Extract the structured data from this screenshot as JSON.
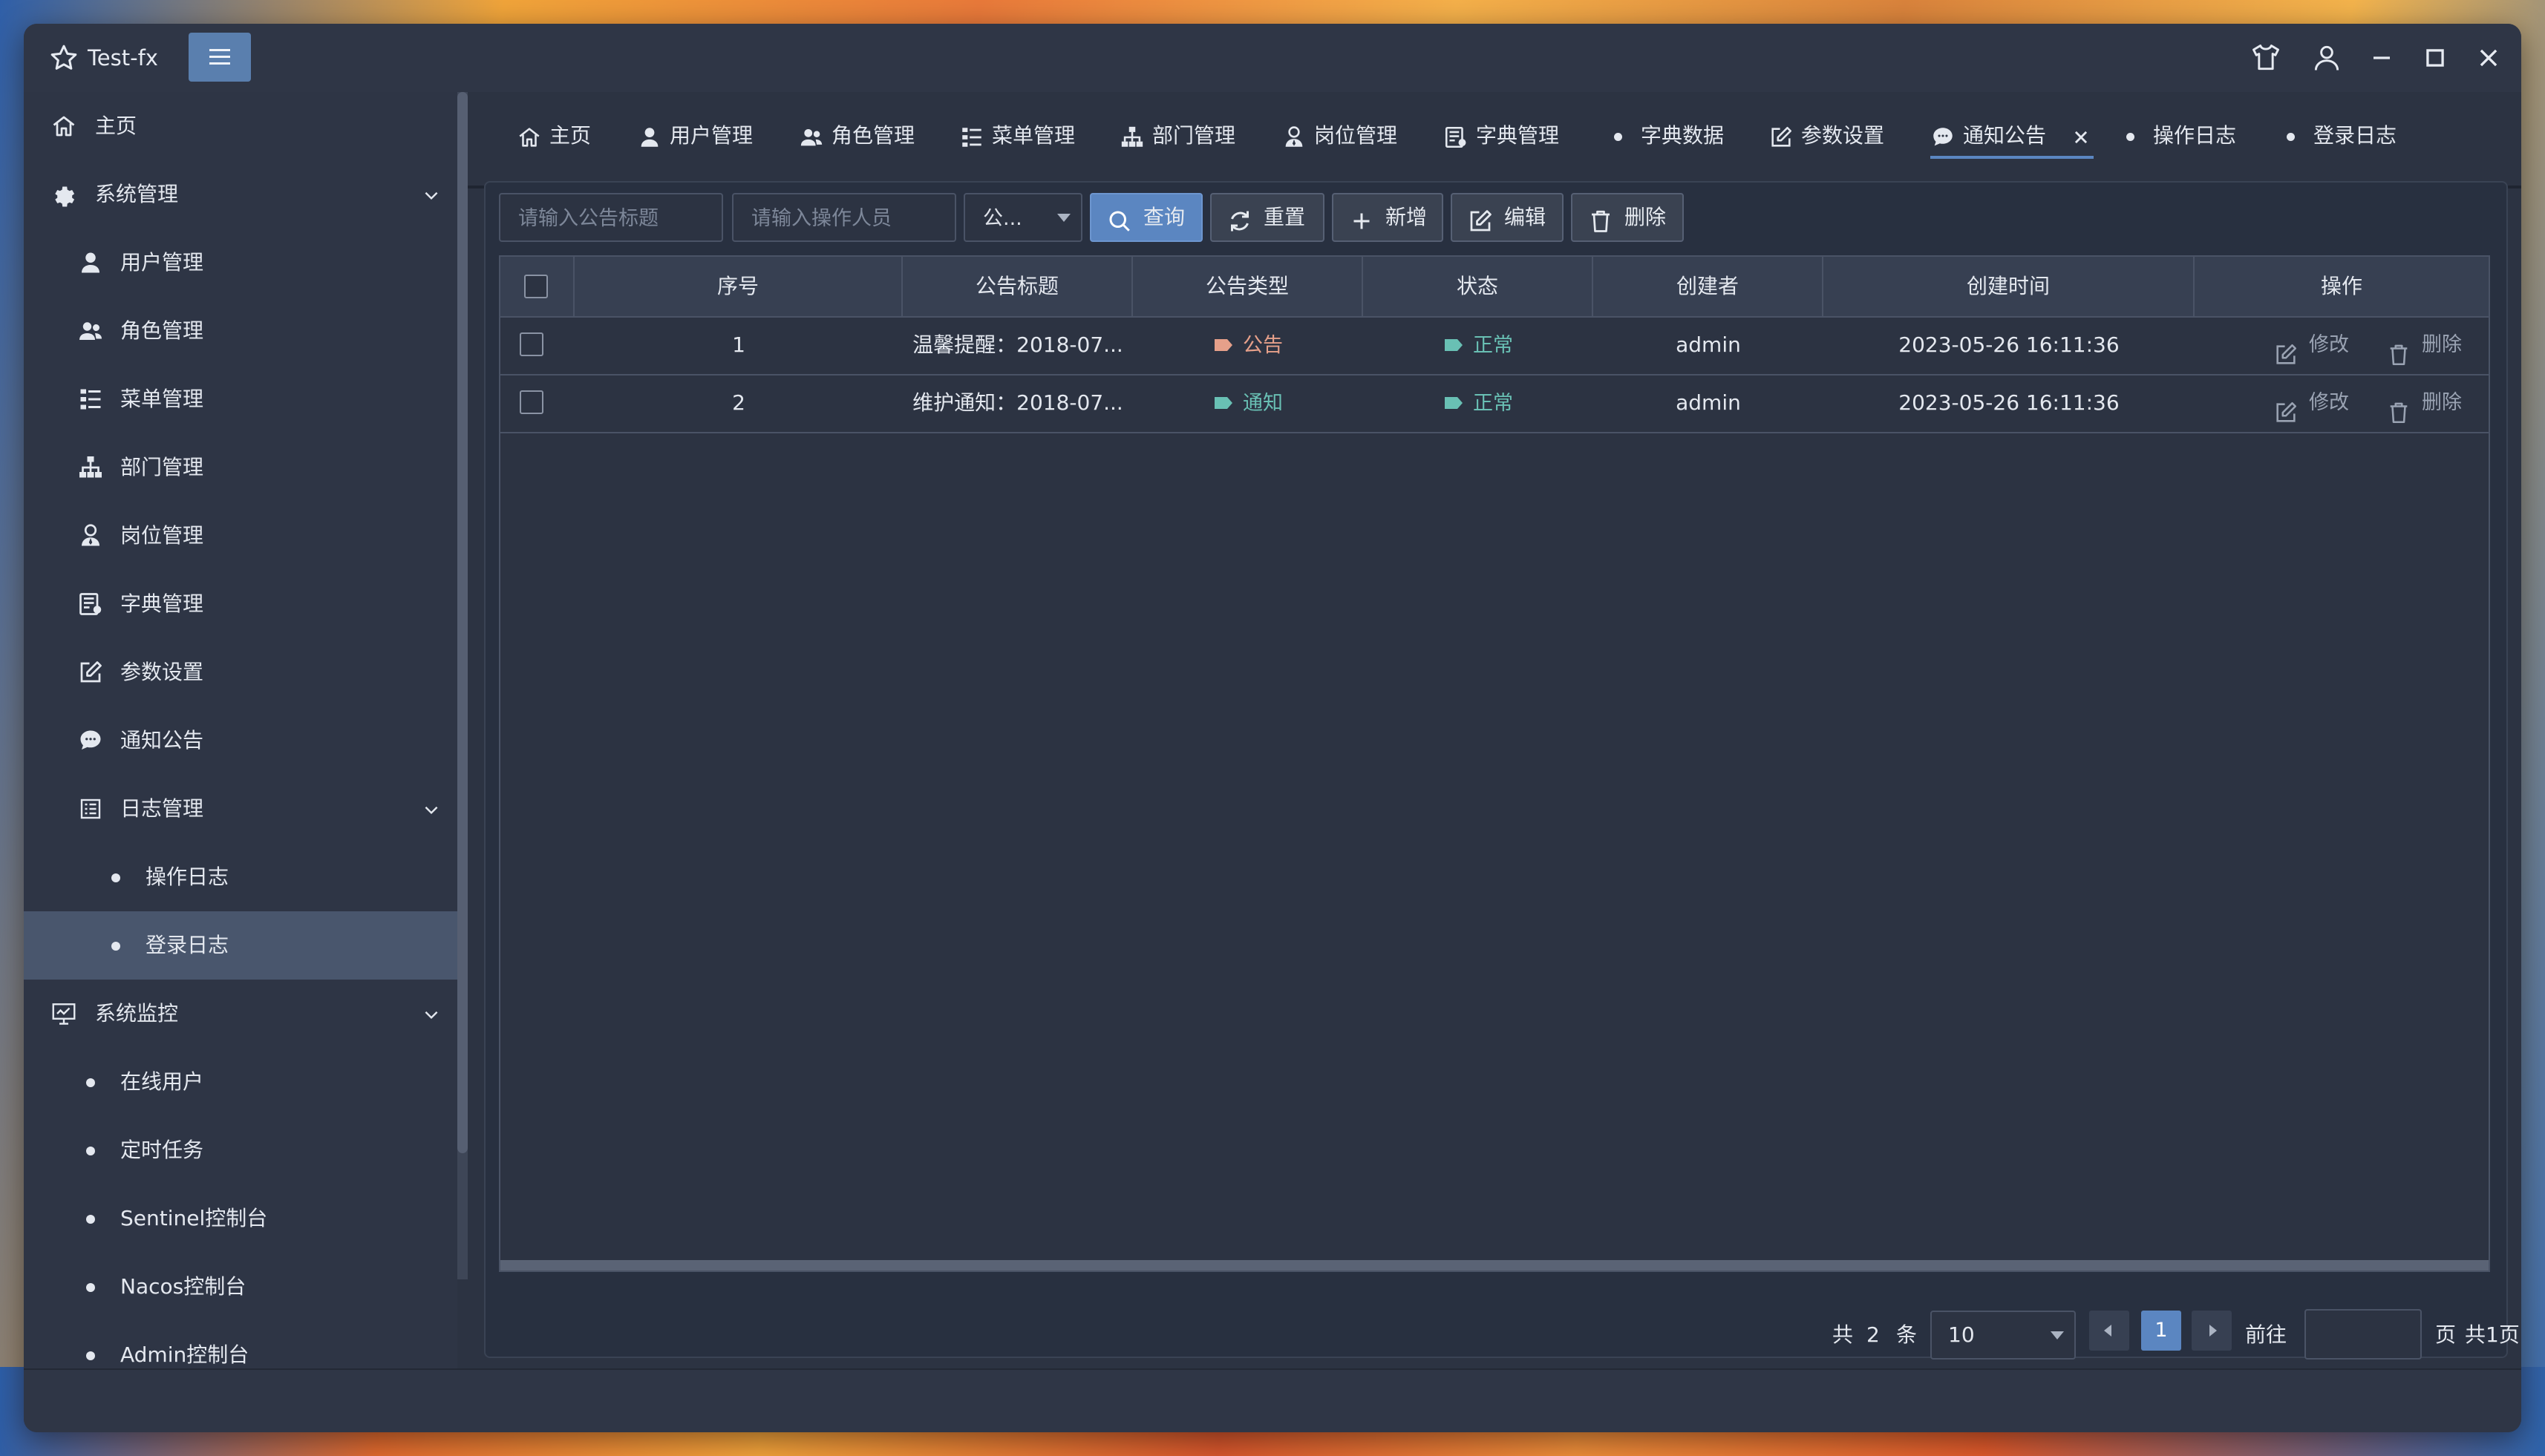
{
  "app": {
    "title": "Test-fx"
  },
  "colors": {
    "accent": "#5b86c1",
    "window_bg": "#2c3342",
    "sidebar_bg": "#2e3545",
    "active_item": "#49566d",
    "tag_notice_color": "#e6a08a",
    "tag_info_color": "#69c0b4"
  },
  "sidebar": {
    "home": "主页",
    "system": "系统管理",
    "user": "用户管理",
    "role": "角色管理",
    "menu": "菜单管理",
    "dept": "部门管理",
    "post": "岗位管理",
    "dict": "字典管理",
    "config": "参数设置",
    "notice": "通知公告",
    "log": "日志管理",
    "oplog": "操作日志",
    "loginlog": "登录日志",
    "monitor": "系统监控",
    "online": "在线用户",
    "job": "定时任务",
    "sentinel": "Sentinel控制台",
    "nacos": "Nacos控制台",
    "admin": "Admin控制台"
  },
  "tabs": [
    {
      "label": "主页",
      "icon": "home-icon"
    },
    {
      "label": "用户管理",
      "icon": "user-icon"
    },
    {
      "label": "角色管理",
      "icon": "users-icon"
    },
    {
      "label": "菜单管理",
      "icon": "menu-tree-icon"
    },
    {
      "label": "部门管理",
      "icon": "org-chart-icon"
    },
    {
      "label": "岗位管理",
      "icon": "user-tie-icon"
    },
    {
      "label": "字典管理",
      "icon": "dictionary-icon"
    },
    {
      "label": "字典数据",
      "icon": "dot-icon"
    },
    {
      "label": "参数设置",
      "icon": "edit-icon"
    },
    {
      "label": "通知公告",
      "icon": "comment-icon",
      "active": true
    },
    {
      "label": "操作日志",
      "icon": "dot-icon"
    },
    {
      "label": "登录日志",
      "icon": "dot-icon"
    }
  ],
  "toolbar": {
    "title_placeholder": "请输入公告标题",
    "operator_placeholder": "请输入操作人员",
    "type_select": "公...",
    "search": "查询",
    "reset": "重置",
    "add": "新增",
    "edit": "编辑",
    "delete": "删除"
  },
  "table": {
    "columns": [
      "序号",
      "公告标题",
      "公告类型",
      "状态",
      "创建者",
      "创建时间",
      "操作"
    ],
    "rows": [
      {
        "index": "1",
        "title": "温馨提醒：2018-07...",
        "type": "公告",
        "status": "正常",
        "creator": "admin",
        "created": "2023-05-26 16:11:36",
        "edit": "修改",
        "delete": "删除"
      },
      {
        "index": "2",
        "title": "维护通知：2018-07...",
        "type": "通知",
        "status": "正常",
        "creator": "admin",
        "created": "2023-05-26 16:11:36",
        "edit": "修改",
        "delete": "删除"
      }
    ]
  },
  "pagination": {
    "total_prefix": "共",
    "total": "2",
    "total_suffix": "条",
    "page_size": "10",
    "current_page": "1",
    "goto_label": "前往",
    "page_suffix": "页",
    "total_pages": "共1页"
  }
}
